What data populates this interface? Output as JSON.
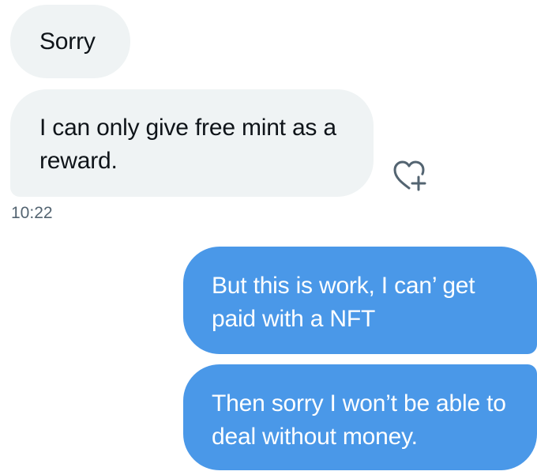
{
  "conversation": {
    "messages": [
      {
        "direction": "incoming",
        "text": "Sorry"
      },
      {
        "direction": "incoming",
        "text": "I can only give free mint as a reward."
      },
      {
        "direction": "outgoing",
        "text": "But this is work, I can’ get paid with a NFT"
      },
      {
        "direction": "outgoing",
        "text": "Then sorry I won’t be able to deal without money."
      }
    ],
    "timestamp": "10:22",
    "reaction_icon": "heart-plus-icon"
  },
  "colors": {
    "incoming_bubble": "#eff3f4",
    "outgoing_bubble": "#4a98e8",
    "timestamp_text": "#536471"
  }
}
